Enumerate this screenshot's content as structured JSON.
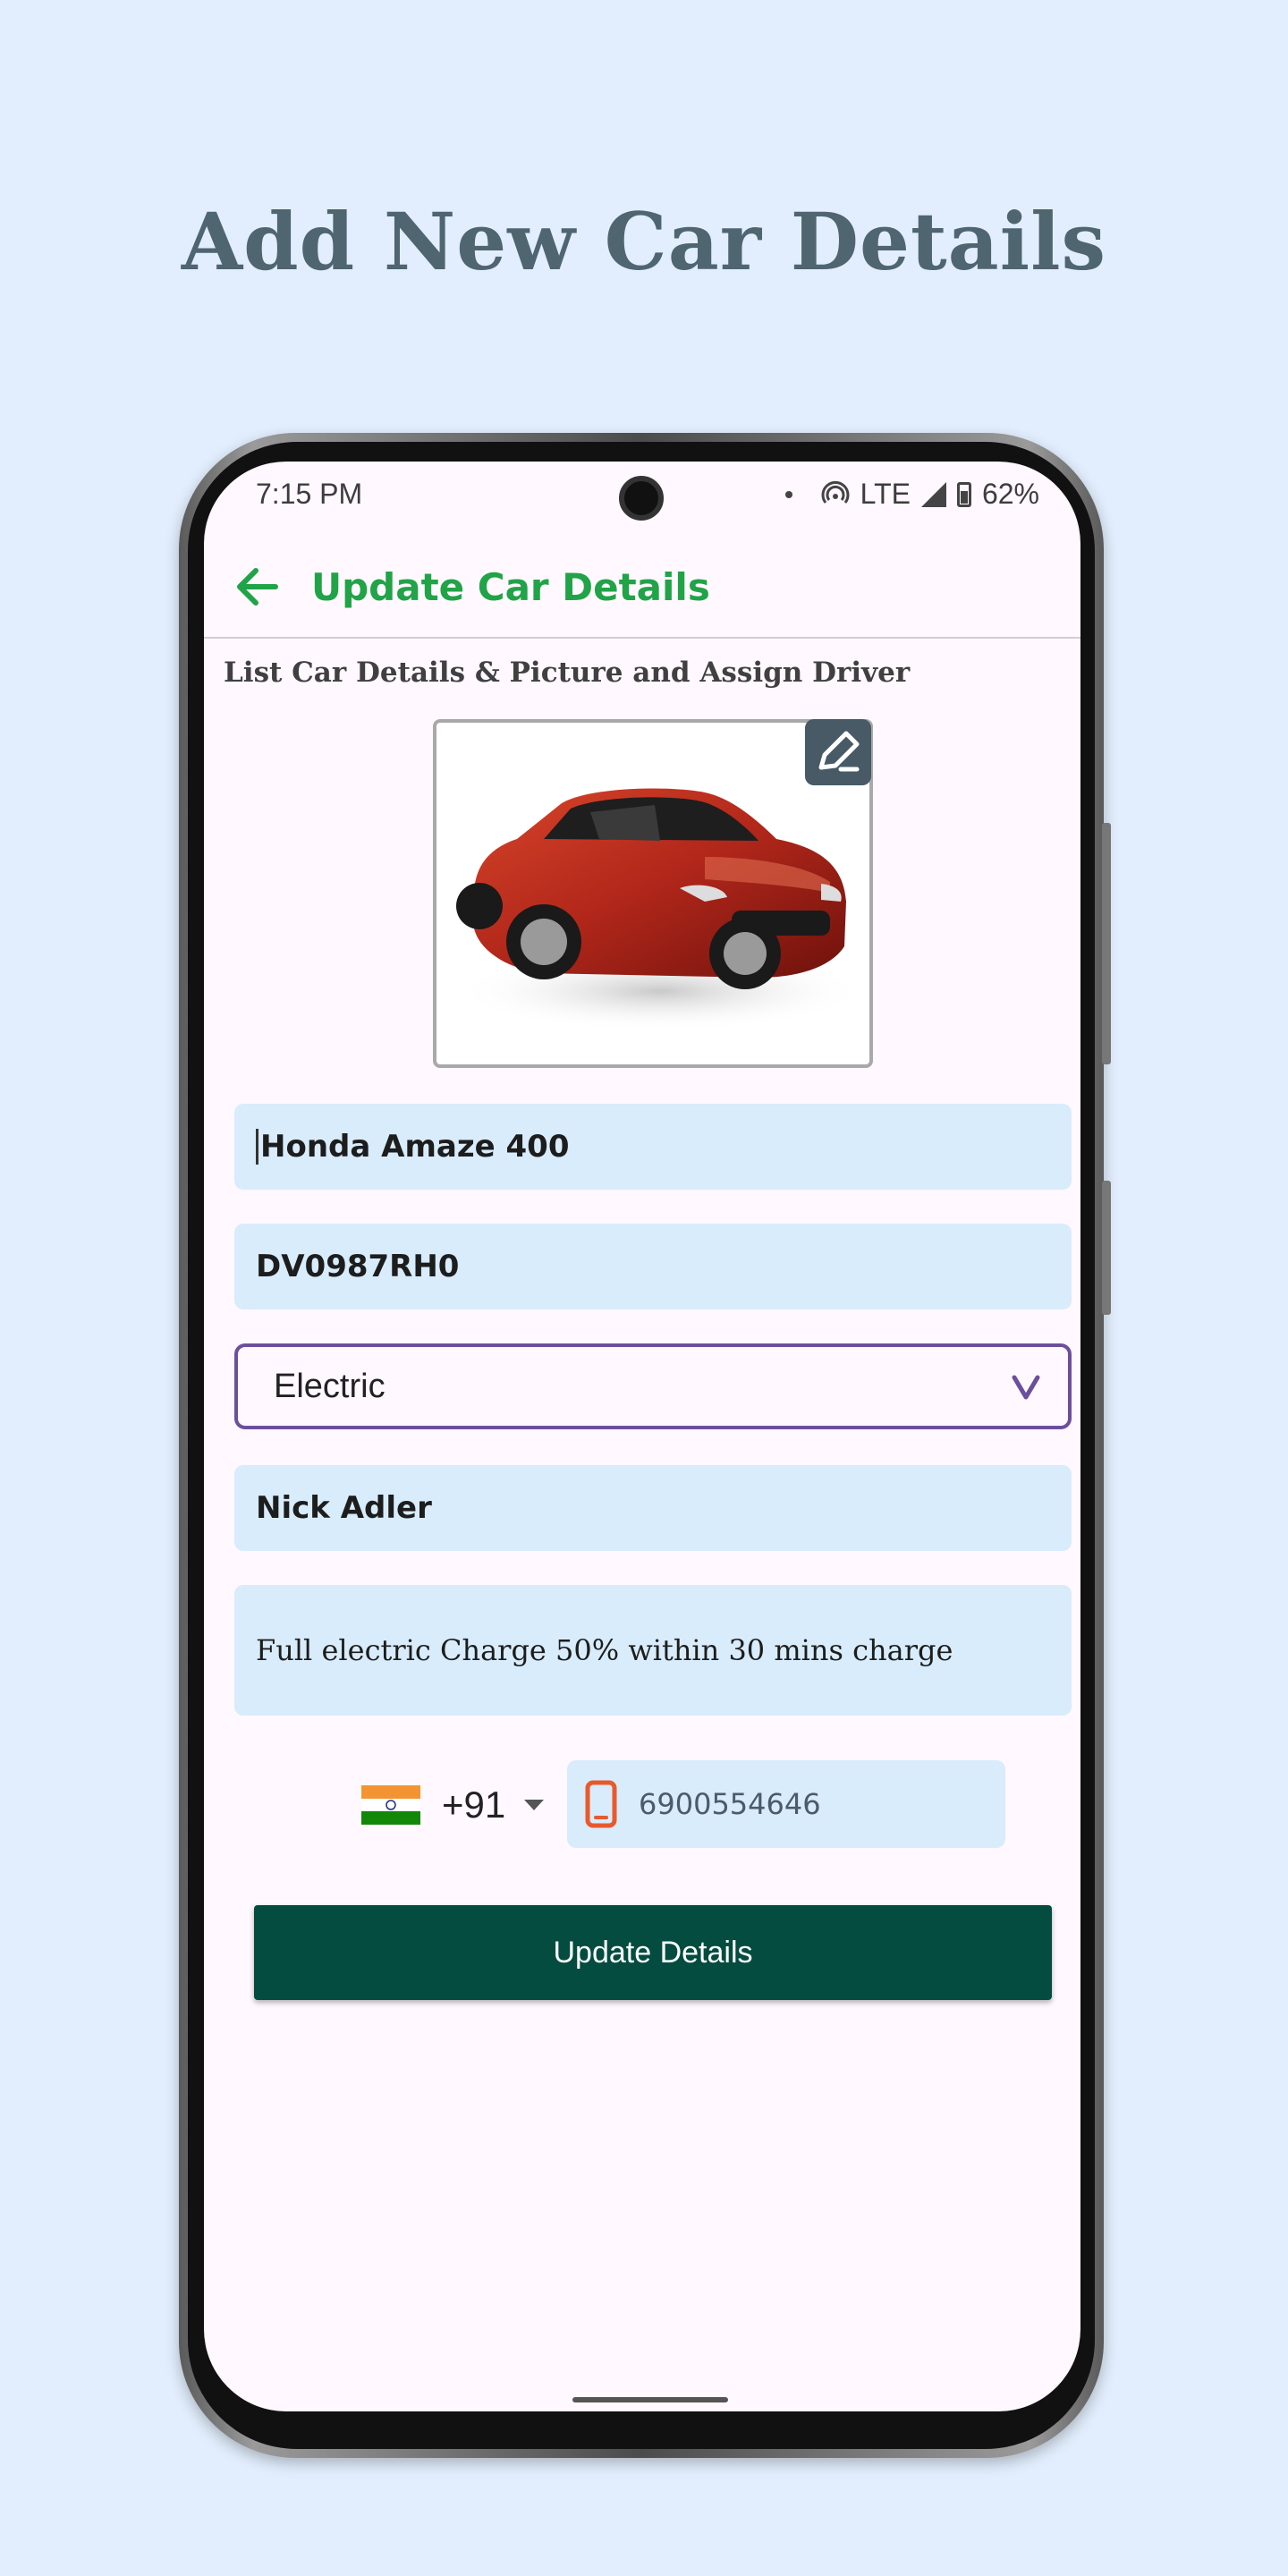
{
  "headline": "Add New Car Details",
  "status_bar": {
    "time": "7:15 PM",
    "network": "LTE",
    "battery": "62%"
  },
  "appbar": {
    "title": "Update Car Details"
  },
  "subtitle": "List Car Details & Picture and Assign Driver",
  "form": {
    "car_name": "Honda Amaze 400",
    "car_number": "DV0987RH0",
    "fuel_type": "Electric",
    "driver_name": "Nick Adler",
    "description": "Full electric Charge 50% within 30 mins charge",
    "country_code": "+91",
    "phone_number": "6900554646",
    "submit_label": "Update Details"
  },
  "colors": {
    "accent_green": "#21a348",
    "button_bg": "#034c3f",
    "field_bg": "#d8ecfb",
    "select_border": "#6c4f9c",
    "phone_icon": "#e85a2c"
  }
}
